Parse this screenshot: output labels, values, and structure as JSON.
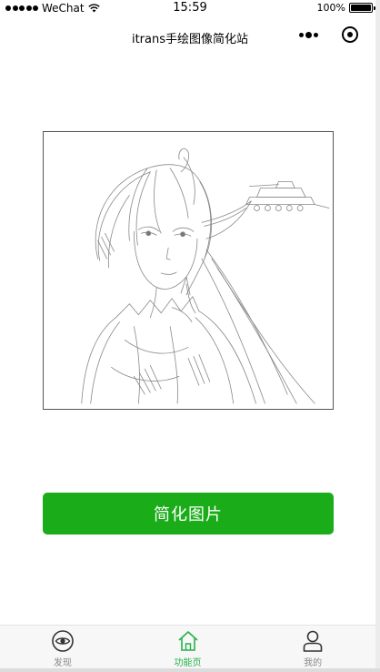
{
  "status_bar": {
    "carrier": "WeChat",
    "time": "15:59",
    "battery_text": "100%",
    "battery_level": 1.0
  },
  "nav": {
    "title": "itrans手绘图像简化站"
  },
  "main": {
    "button_label": "简化图片",
    "image_icon": "anime-sketch-image"
  },
  "tabbar": {
    "items": [
      {
        "label": "发现",
        "icon": "eye-icon",
        "active": false
      },
      {
        "label": "功能页",
        "icon": "home-icon",
        "active": true
      },
      {
        "label": "我的",
        "icon": "person-icon",
        "active": false
      }
    ]
  },
  "colors": {
    "primary_green": "#1aad19",
    "active_tab": "#23b24a",
    "inactive_tab": "#8a8a8a"
  }
}
